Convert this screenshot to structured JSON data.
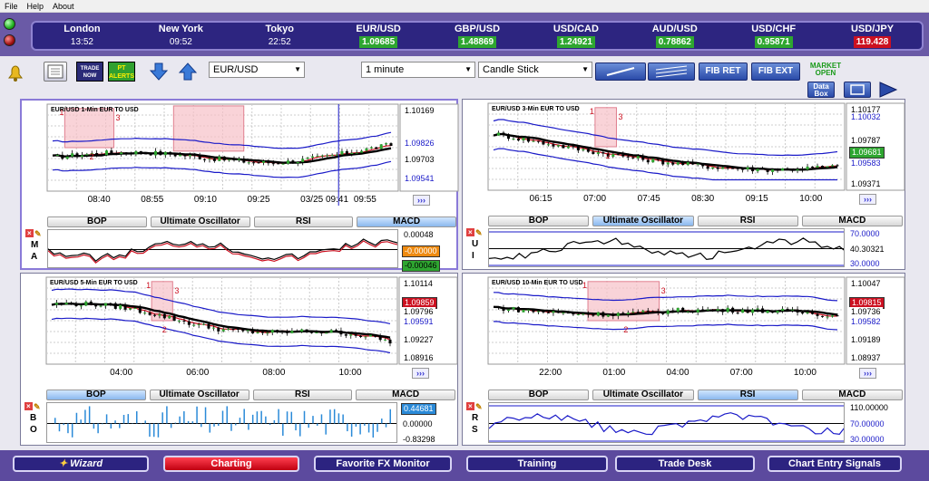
{
  "menu": [
    "File",
    "Help",
    "About"
  ],
  "ticker": [
    {
      "name": "London",
      "value": "13:52",
      "kind": "time"
    },
    {
      "name": "New York",
      "value": "09:52",
      "kind": "time"
    },
    {
      "name": "Tokyo",
      "value": "22:52",
      "kind": "time"
    },
    {
      "name": "EUR/USD",
      "value": "1.09685",
      "kind": "up"
    },
    {
      "name": "GBP/USD",
      "value": "1.48869",
      "kind": "up"
    },
    {
      "name": "USD/CAD",
      "value": "1.24921",
      "kind": "up"
    },
    {
      "name": "AUD/USD",
      "value": "0.78862",
      "kind": "up"
    },
    {
      "name": "USD/CHF",
      "value": "0.95871",
      "kind": "up"
    },
    {
      "name": "USD/JPY",
      "value": "119.428",
      "kind": "down"
    }
  ],
  "toolbar": {
    "trade_now": "TRADE NOW",
    "pt_alerts": "PT ALERTS",
    "symbol": "EUR/USD",
    "interval": "1 minute",
    "chart_type": "Candle Stick",
    "fib_ret": "FIB RET",
    "fib_ext": "FIB EXT",
    "market_open": "MARKET OPEN",
    "data_box": "Data Box"
  },
  "charts": [
    {
      "title": "EUR/USD 1-Min EUR TO USD",
      "axis_top": "1.10169",
      "tags": [
        {
          "text": "1.09826",
          "color": "#1a1ac8",
          "bg": "#fff"
        },
        {
          "text": "1.09703",
          "color": "#000",
          "bg": "#fff"
        },
        {
          "text": "1.09541",
          "color": "#1a1ac8",
          "bg": "#fff"
        }
      ],
      "x_ticks": [
        "08:40",
        "08:55",
        "09:10",
        "09:25",
        "03/25 09:41",
        "09:55"
      ],
      "tabs": [
        "BOP",
        "Ultimate Oscillator",
        "RSI",
        "MACD"
      ],
      "active_tab": 3,
      "side": [
        "M",
        "A"
      ],
      "ind_values": [
        {
          "text": "0.00048",
          "color": "#000",
          "bg": "#fff"
        },
        {
          "text": "-0.00000",
          "color": "#fff",
          "bg": "#ee8a10"
        },
        {
          "text": "-0.00046",
          "color": "#000",
          "bg": "#2ea630"
        }
      ],
      "wave": {
        "a": "1",
        "b": "2",
        "c": "3"
      }
    },
    {
      "title": "EUR/USD 3-Min EUR TO USD",
      "axis_top": "1.10177",
      "tags": [
        {
          "text": "1.10032",
          "color": "#1a1ac8",
          "bg": "#fff"
        },
        {
          "text": "1.09787",
          "color": "#000",
          "bg": "#fff"
        },
        {
          "text": "1.09681",
          "color": "#fff",
          "bg": "#2ea630"
        },
        {
          "text": "1.09583",
          "color": "#1a1ac8",
          "bg": "#fff"
        }
      ],
      "axis_bottom": "1.09371",
      "x_ticks": [
        "06:15",
        "07:00",
        "07:45",
        "08:30",
        "09:15",
        "10:00"
      ],
      "tabs": [
        "BOP",
        "Ultimate Oscillator",
        "RSI",
        "MACD"
      ],
      "active_tab": 1,
      "side": [
        "U",
        "I"
      ],
      "ind_values": [
        {
          "text": "70.0000",
          "color": "#1a1ac8",
          "bg": "#fff"
        },
        {
          "text": "40.30321",
          "color": "#000",
          "bg": "#fff"
        },
        {
          "text": "30.0000",
          "color": "#1a1ac8",
          "bg": "#fff"
        }
      ],
      "wave": {
        "a": "1",
        "b": "2",
        "c": "3"
      }
    },
    {
      "title": "EUR/USD 5-Min EUR TO USD",
      "axis_top": "1.10114",
      "tags": [
        {
          "text": "1.09859",
          "color": "#fff",
          "bg": "#cc1020"
        },
        {
          "text": "1.09796",
          "color": "#000",
          "bg": "#fff"
        },
        {
          "text": "1.09591",
          "color": "#1a1ac8",
          "bg": "#fff"
        }
      ],
      "axis_mid": "1.09227",
      "axis_bottom": "1.08916",
      "x_ticks": [
        "04:00",
        "06:00",
        "08:00",
        "10:00"
      ],
      "tabs": [
        "BOP",
        "Ultimate Oscillator",
        "RSI",
        "MACD"
      ],
      "active_tab": 0,
      "side": [
        "B",
        "O"
      ],
      "ind_values": [
        {
          "text": "0.44681",
          "color": "#fff",
          "bg": "#2a8ad8"
        },
        {
          "text": "0.00000",
          "color": "#000",
          "bg": "#fff"
        },
        {
          "text": "-0.83298",
          "color": "#000",
          "bg": "#fff"
        }
      ],
      "wave": {
        "a": "1",
        "b": "2",
        "c": "3"
      }
    },
    {
      "title": "EUR/USD 10-Min EUR TO USD",
      "axis_top": "1.10047",
      "tags": [
        {
          "text": "1.09815",
          "color": "#fff",
          "bg": "#cc1020"
        },
        {
          "text": "1.09736",
          "color": "#000",
          "bg": "#fff"
        },
        {
          "text": "1.09582",
          "color": "#1a1ac8",
          "bg": "#fff"
        }
      ],
      "axis_mid": "1.09189",
      "axis_bottom": "1.08937",
      "x_ticks": [
        "22:00",
        "01:00",
        "04:00",
        "07:00",
        "10:00"
      ],
      "tabs": [
        "BOP",
        "Ultimate Oscillator",
        "RSI",
        "MACD"
      ],
      "active_tab": 2,
      "side": [
        "R",
        "S"
      ],
      "ind_values": [
        {
          "text": "110.00000",
          "color": "#000",
          "bg": "#fff"
        },
        {
          "text": "70.00000",
          "color": "#1a1ac8",
          "bg": "#fff"
        },
        {
          "text": "30.00000",
          "color": "#1a1ac8",
          "bg": "#fff"
        }
      ],
      "wave": {
        "a": "1",
        "b": "2",
        "c": "3"
      }
    }
  ],
  "bottom_nav": [
    "Wizard",
    "Charting",
    "Favorite FX Monitor",
    "Training",
    "Trade Desk",
    "Chart Entry Signals"
  ],
  "colors": {
    "frame": "#6a5aa6",
    "ticker_bg": "#2d2580",
    "up": "#2ea630",
    "down": "#cc1020",
    "band": "#1a1ac8",
    "ma": "#000000",
    "signal": "#cc1020"
  }
}
